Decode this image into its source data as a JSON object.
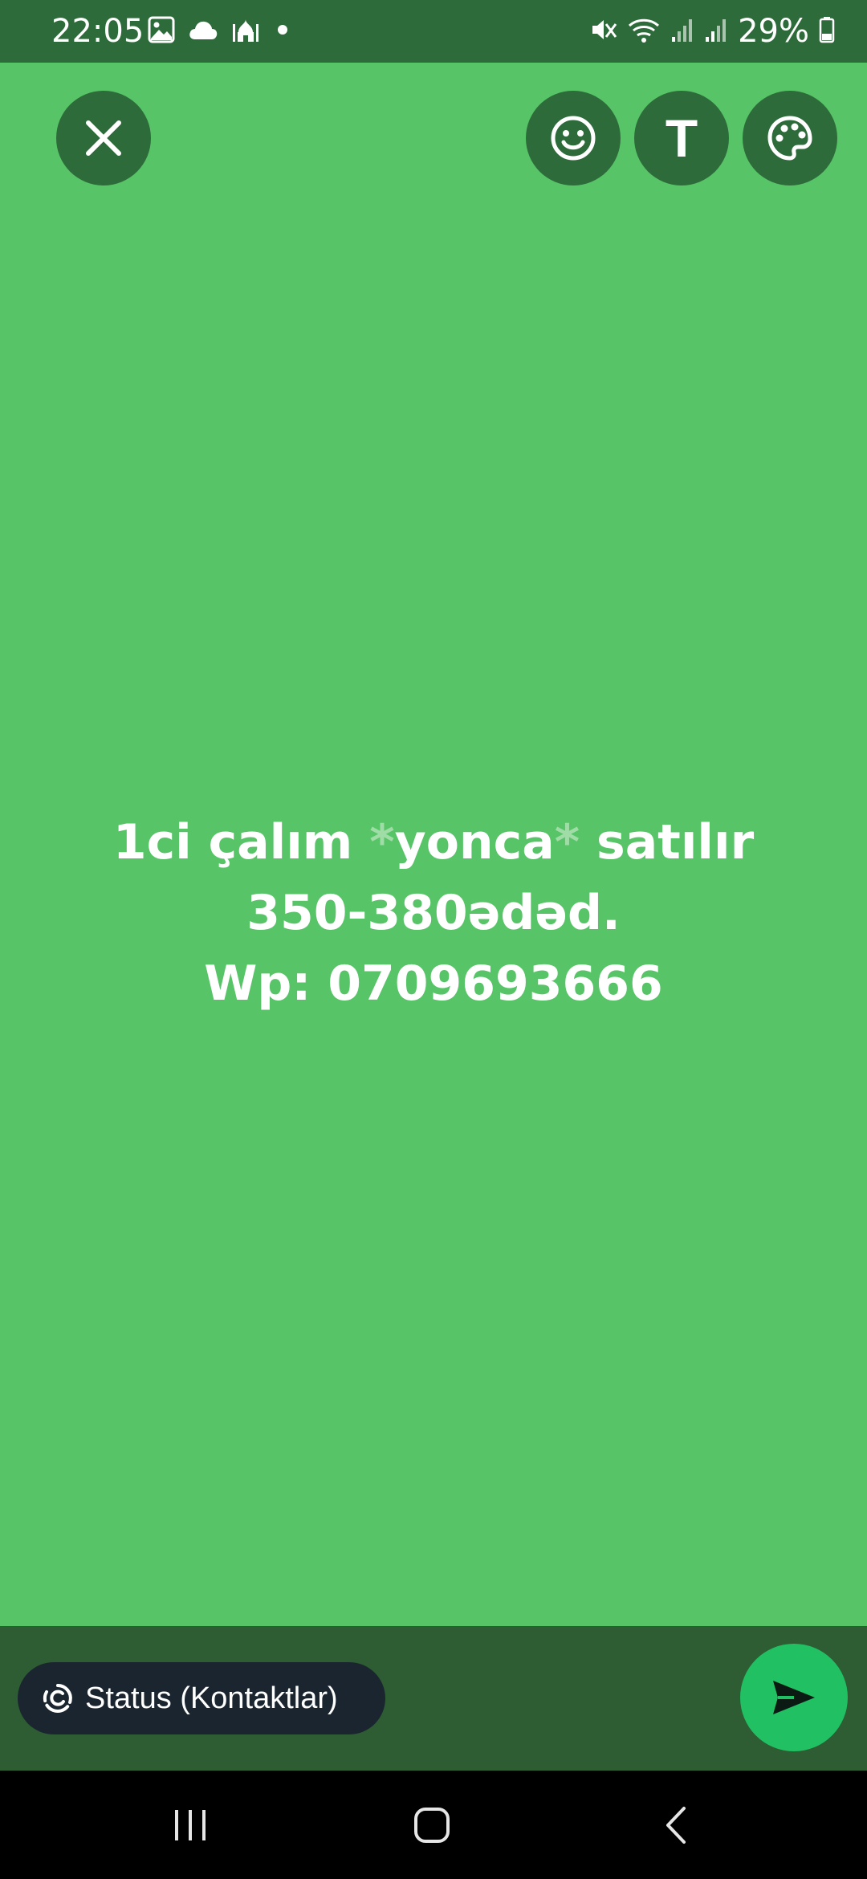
{
  "status_bar": {
    "time": "22:05",
    "battery": "29%",
    "left_icons": [
      "gallery-icon",
      "cloud-icon",
      "mosque-icon",
      "dot-icon"
    ],
    "right_icons": [
      "mute-icon",
      "wifi-icon",
      "signal-icon",
      "signal-icon",
      "battery-icon"
    ]
  },
  "toolbar": {
    "close_icon": "close-icon",
    "emoji_icon": "smiley-icon",
    "text_label": "T",
    "palette_icon": "palette-icon"
  },
  "status": {
    "line1_a": "1ci çalım ",
    "line1_star1": "*",
    "line1_b": "yonca",
    "line1_star2": "*",
    "line1_c": " satılır",
    "line2": "350-380ədəd.",
    "line3": "Wp: 0709693666",
    "background_color": "#57c467"
  },
  "bottom": {
    "audience_label": "Status (Kontaktlar)",
    "send_icon": "send-icon"
  },
  "nav": {
    "recents_icon": "recents-icon",
    "home_icon": "home-icon",
    "back_icon": "back-icon"
  }
}
